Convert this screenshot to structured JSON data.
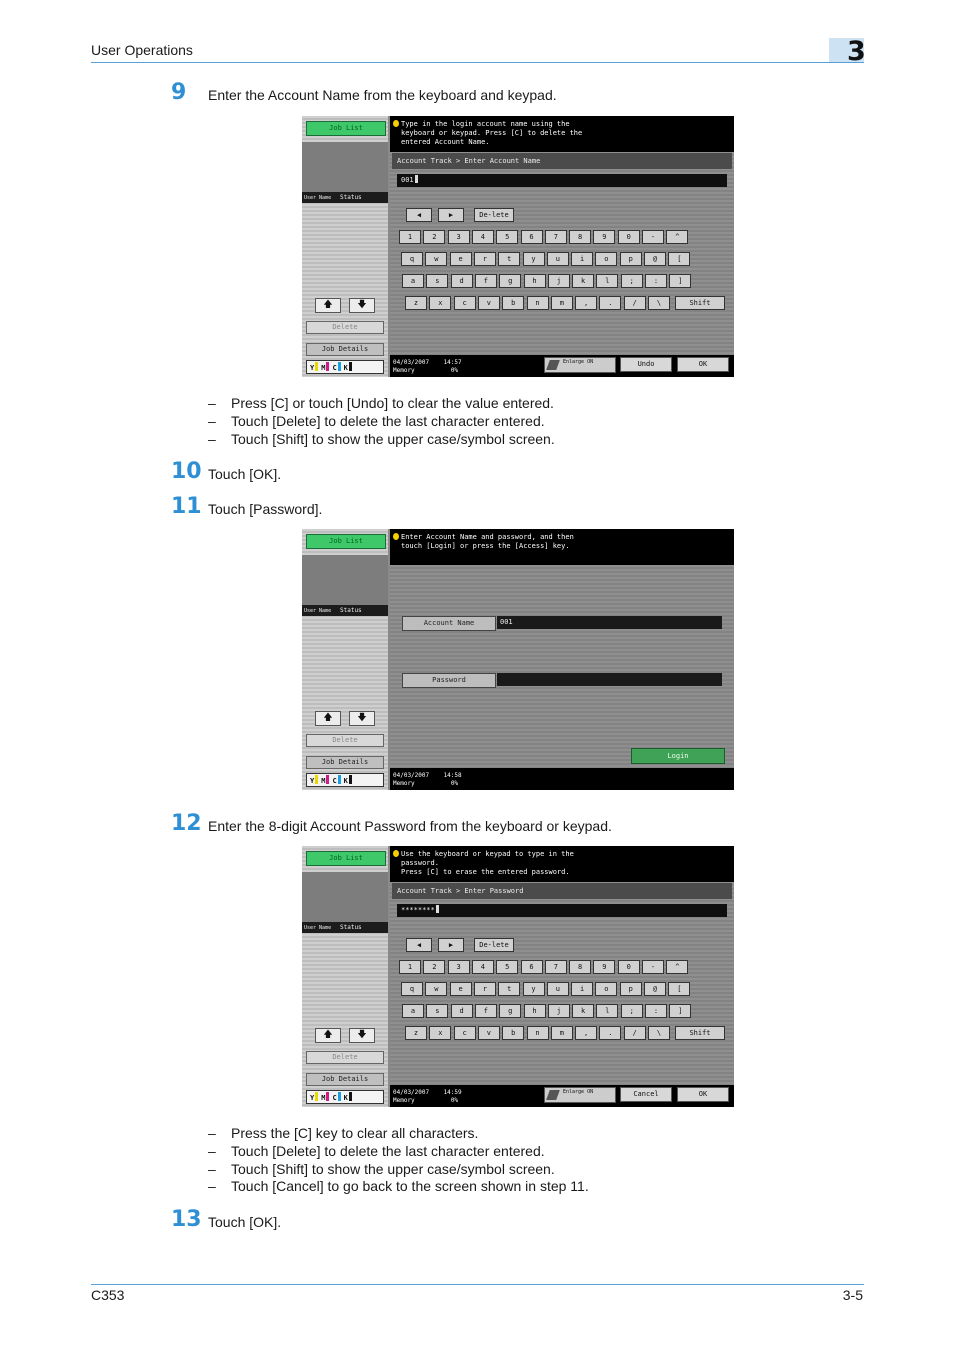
{
  "header": {
    "section": "User Operations",
    "chapter": "3"
  },
  "steps": {
    "s9": {
      "num": "9",
      "text": "Enter the Account Name from the keyboard and keypad."
    },
    "s10": {
      "num": "10",
      "text": "Touch [OK]."
    },
    "s11": {
      "num": "11",
      "text": "Touch [Password]."
    },
    "s12": {
      "num": "12",
      "text": "Enter the 8-digit Account Password from the keyboard or keypad."
    },
    "s13": {
      "num": "13",
      "text": "Touch [OK]."
    }
  },
  "notes9": [
    "Press [C] or touch [Undo] to clear the value entered.",
    "Touch [Delete] to delete the last character entered.",
    "Touch [Shift] to show the upper case/symbol screen."
  ],
  "notes12": [
    "Press the [C] key to clear all characters.",
    "Touch [Delete] to delete the last character entered.",
    "Touch [Shift] to show the upper case/symbol screen.",
    "Touch [Cancel] to go back to the screen shown in step 11."
  ],
  "dash": "–",
  "footer": {
    "model": "C353",
    "page": "3-5"
  },
  "common": {
    "job_list": "Job List",
    "user_name": "User Name",
    "status": "Status",
    "delete": "Delete",
    "job_details": "Job Details",
    "toner": [
      "Y",
      "M",
      "C",
      "K"
    ],
    "toner_colors": [
      "#e8d800",
      "#d01c8b",
      "#1aa0e0",
      "#111111"
    ],
    "memory_label": "Memory",
    "memory_value": "0%",
    "enlarge": "Enlarge ON",
    "del_key": "De-lete",
    "shift": "Shift",
    "ok": "OK",
    "keys_row1": [
      "1",
      "2",
      "3",
      "4",
      "5",
      "6",
      "7",
      "8",
      "9",
      "0",
      "-",
      "^"
    ],
    "keys_row2": [
      "q",
      "w",
      "e",
      "r",
      "t",
      "y",
      "u",
      "i",
      "o",
      "p",
      "@",
      "["
    ],
    "keys_row3": [
      "a",
      "s",
      "d",
      "f",
      "g",
      "h",
      "j",
      "k",
      "l",
      ";",
      ":",
      "]"
    ],
    "keys_row4": [
      "z",
      "x",
      "c",
      "v",
      "b",
      "n",
      "m",
      ",",
      ".",
      "/",
      "\\"
    ]
  },
  "screen1": {
    "message": "Type in the login account name using the\nkeyboard or keypad. Press [C] to delete the\nentered Account Name.",
    "breadcrumb": "Account Track > Enter Account Name",
    "value": "001",
    "datetime": "04/03/2007    14:57",
    "undo": "Undo"
  },
  "screen2": {
    "message": "Enter Account Name and password, and then\ntouch [Login] or press the [Access] key.",
    "account_label": "Account Name",
    "account_value": "001",
    "password_label": "Password",
    "login": "Login",
    "datetime": "04/03/2007    14:58"
  },
  "screen3": {
    "message": "Use the keyboard or keypad to type in the\npassword.\nPress [C] to erase the entered password.",
    "breadcrumb": "Account Track > Enter Password",
    "value": "********",
    "datetime": "04/03/2007    14:59",
    "cancel": "Cancel"
  }
}
